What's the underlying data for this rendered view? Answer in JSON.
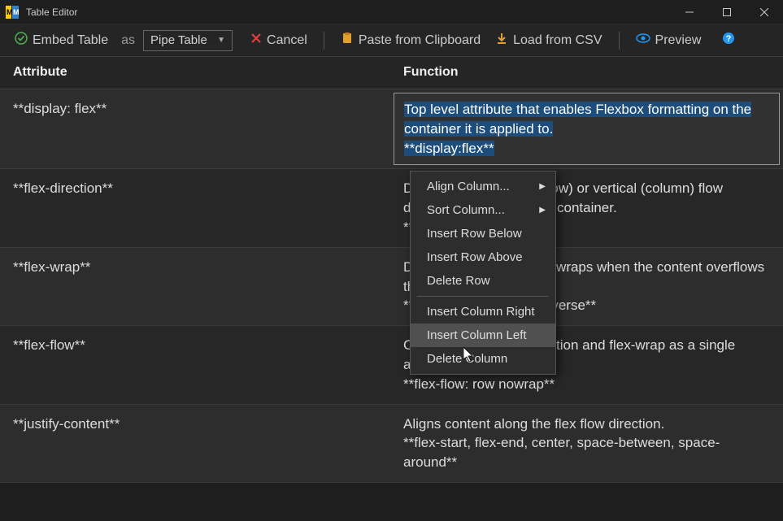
{
  "window": {
    "title": "Table Editor"
  },
  "toolbar": {
    "embed_label": "Embed Table",
    "as_label": "as",
    "mode_selected": "Pipe Table",
    "cancel_label": "Cancel",
    "paste_label": "Paste from Clipboard",
    "csv_label": "Load from CSV",
    "preview_label": "Preview"
  },
  "table": {
    "headers": {
      "attribute": "Attribute",
      "function": "Function"
    },
    "rows": [
      {
        "attribute": "**display: flex**",
        "function": "Top level attribute that enables Flexbox formatting on the container it is applied to.\n**display:flex**",
        "editing": true
      },
      {
        "attribute": "**flex-direction**",
        "function": "Determines horizontal (row) or vertical (column) flow direction elements in the container.\n**row,column**"
      },
      {
        "attribute": "**flex-wrap**",
        "function": "Determines how content wraps when the content overflows the container.\n**wrap, nowrap, wrap-reverse**"
      },
      {
        "attribute": "**flex-flow**",
        "function": "Combination of flex-direction and flex-wrap as a single attribute.\n**flex-flow: row nowrap**"
      },
      {
        "attribute": "**justify-content**",
        "function": "Aligns content along the flex flow direction.\n**flex-start, flex-end, center, space-between, space-around**"
      }
    ]
  },
  "context_menu": {
    "items": [
      {
        "label": "Align Column...",
        "submenu": true
      },
      {
        "label": "Sort Column...",
        "submenu": true
      },
      {
        "label": "Insert Row Below"
      },
      {
        "label": "Insert Row Above"
      },
      {
        "label": "Delete Row"
      },
      {
        "divider": true
      },
      {
        "label": "Insert Column Right"
      },
      {
        "label": "Insert Column Left",
        "hover": true
      },
      {
        "label": "Delete Column"
      }
    ]
  },
  "colors": {
    "selection_bg": "#1d4d7a",
    "accent_green": "#4caf50",
    "accent_red": "#e04040",
    "accent_orange": "#e0a030",
    "accent_blue": "#2196f3"
  }
}
